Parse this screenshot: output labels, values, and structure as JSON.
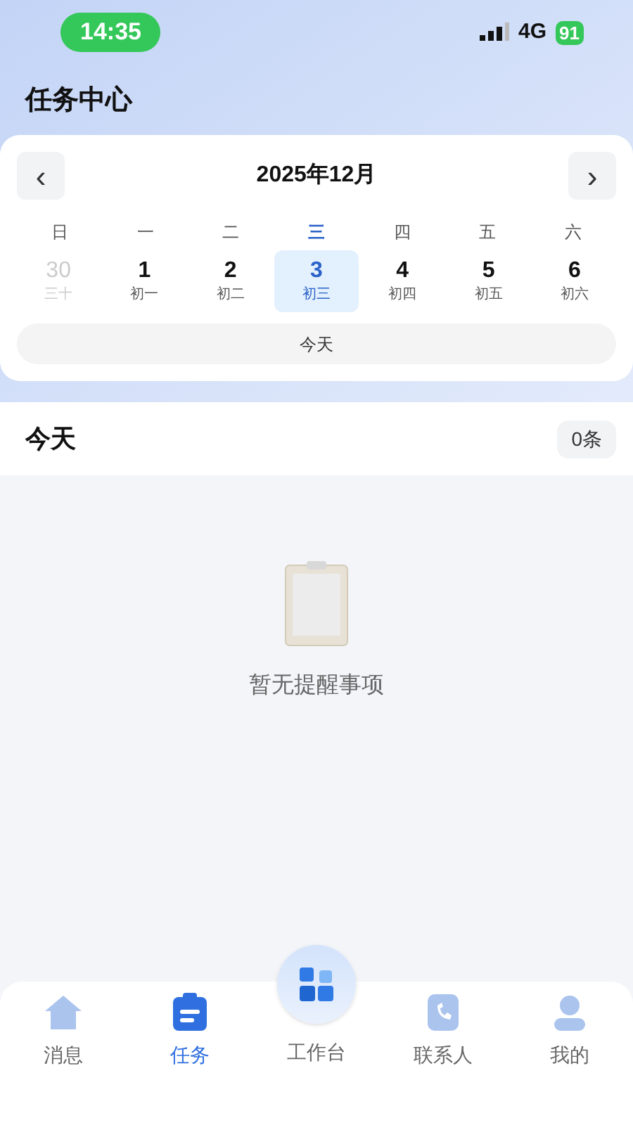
{
  "status_bar": {
    "time": "14:35",
    "network": "4G",
    "battery": "91"
  },
  "title": "任务中心",
  "calendar": {
    "month": "2025年12月",
    "prev": "‹",
    "next": "›",
    "weekdays": [
      {
        "label": "日",
        "selected": false
      },
      {
        "label": "一",
        "selected": false
      },
      {
        "label": "二",
        "selected": false
      },
      {
        "label": "三",
        "selected": true
      },
      {
        "label": "四",
        "selected": false
      },
      {
        "label": "五",
        "selected": false
      },
      {
        "label": "六",
        "selected": false
      }
    ],
    "days": [
      {
        "day": "30",
        "lunar": "三十",
        "dimmed": true,
        "selected": false
      },
      {
        "day": "1",
        "lunar": "初一",
        "dimmed": false,
        "selected": false
      },
      {
        "day": "2",
        "lunar": "初二",
        "dimmed": false,
        "selected": false
      },
      {
        "day": "3",
        "lunar": "初三",
        "dimmed": false,
        "selected": true
      },
      {
        "day": "4",
        "lunar": "初四",
        "dimmed": false,
        "selected": false
      },
      {
        "day": "5",
        "lunar": "初五",
        "dimmed": false,
        "selected": false
      },
      {
        "day": "6",
        "lunar": "初六",
        "dimmed": false,
        "selected": false
      }
    ],
    "today_button": "今天"
  },
  "section": {
    "title": "今天",
    "count": "0条"
  },
  "empty_state": {
    "message": "暂无提醒事项"
  },
  "tab_bar": [
    {
      "label": "消息",
      "kind": "home",
      "selected": false
    },
    {
      "label": "任务",
      "kind": "tasks",
      "selected": true
    },
    {
      "label": "工作台",
      "kind": "center",
      "selected": false
    },
    {
      "label": "联系人",
      "kind": "contacts",
      "selected": false
    },
    {
      "label": "我的",
      "kind": "profile",
      "selected": false
    }
  ]
}
